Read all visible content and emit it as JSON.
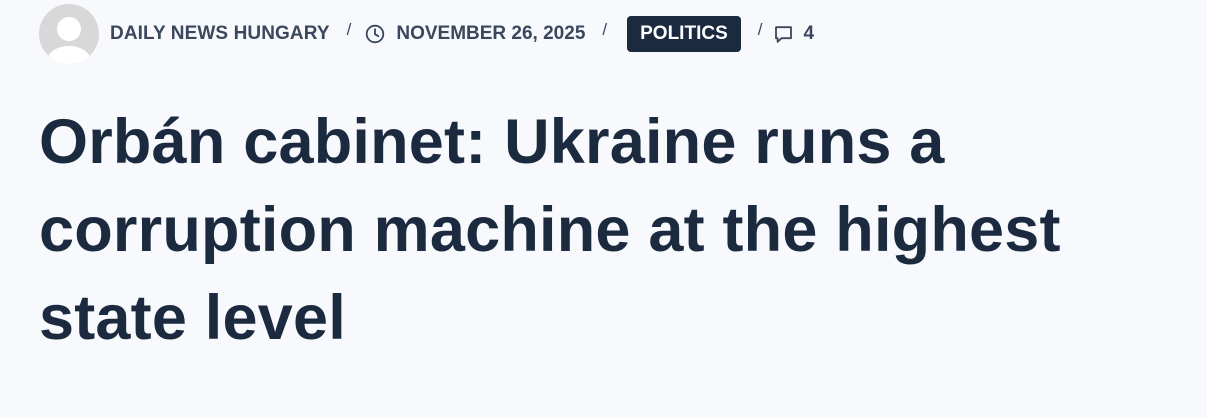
{
  "article_meta": {
    "author": "DAILY NEWS HUNGARY",
    "separator": "/",
    "date": "NOVEMBER 26, 2025",
    "category": "POLITICS",
    "comment_count": "4",
    "icons": {
      "avatar": "avatar-placeholder",
      "date": "clock-icon",
      "comments": "comment-icon"
    }
  },
  "article": {
    "title": "Orbán cabinet: Ukraine runs a corruption machine at the highest state level"
  },
  "colors": {
    "background": "#f8f9fc",
    "text_dark": "#1c2a40",
    "meta_text": "#3a475c",
    "badge_bg": "#1c2a40",
    "badge_text": "#ffffff"
  }
}
